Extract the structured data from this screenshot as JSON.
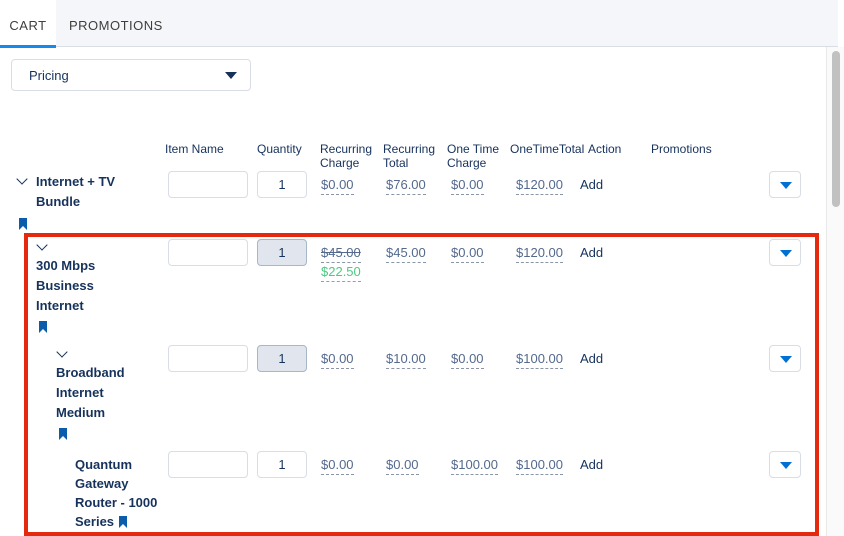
{
  "tabs": [
    {
      "label": "CART",
      "active": true
    },
    {
      "label": "PROMOTIONS",
      "active": false
    }
  ],
  "view_select": {
    "value": "Pricing"
  },
  "columns": {
    "item_name": "Item Name",
    "quantity": "Quantity",
    "recurring_charge_1": "Recurring",
    "recurring_charge_2": "Charge",
    "recurring_total_1": "Recurring",
    "recurring_total_2": "Total",
    "one_time_charge_1": "One Time",
    "one_time_charge_2": "Charge",
    "one_time_total": "OneTimeTotal",
    "action": "Action",
    "promotions": "Promotions"
  },
  "rows": [
    {
      "label_lines": [
        "Internet + TV",
        "Bundle"
      ],
      "quantity": "1",
      "recurring_charge": "$0.00",
      "recurring_total": "$76.00",
      "one_time_charge": "$0.00",
      "one_time_total": "$120.00",
      "action": "Add"
    },
    {
      "label_lines": [
        "300 Mbps",
        "Business",
        "Internet"
      ],
      "quantity": "1",
      "recurring_charge": "$45.00",
      "recurring_charge_discounted": "$22.50",
      "recurring_total": "$45.00",
      "one_time_charge": "$0.00",
      "one_time_total": "$120.00",
      "action": "Add"
    },
    {
      "label_lines": [
        "Broadband",
        "Internet",
        "Medium"
      ],
      "quantity": "1",
      "recurring_charge": "$0.00",
      "recurring_total": "$10.00",
      "one_time_charge": "$0.00",
      "one_time_total": "$100.00",
      "action": "Add"
    },
    {
      "label_lines": [
        "Quantum",
        "Gateway",
        "Router - 1000",
        "Series"
      ],
      "quantity": "1",
      "recurring_charge": "$0.00",
      "recurring_total": "$0.00",
      "one_time_charge": "$100.00",
      "one_time_total": "$100.00",
      "action": "Add"
    }
  ],
  "colors": {
    "highlight": "#e4290e",
    "accent": "#0070d2",
    "discount": "#4bca81"
  }
}
